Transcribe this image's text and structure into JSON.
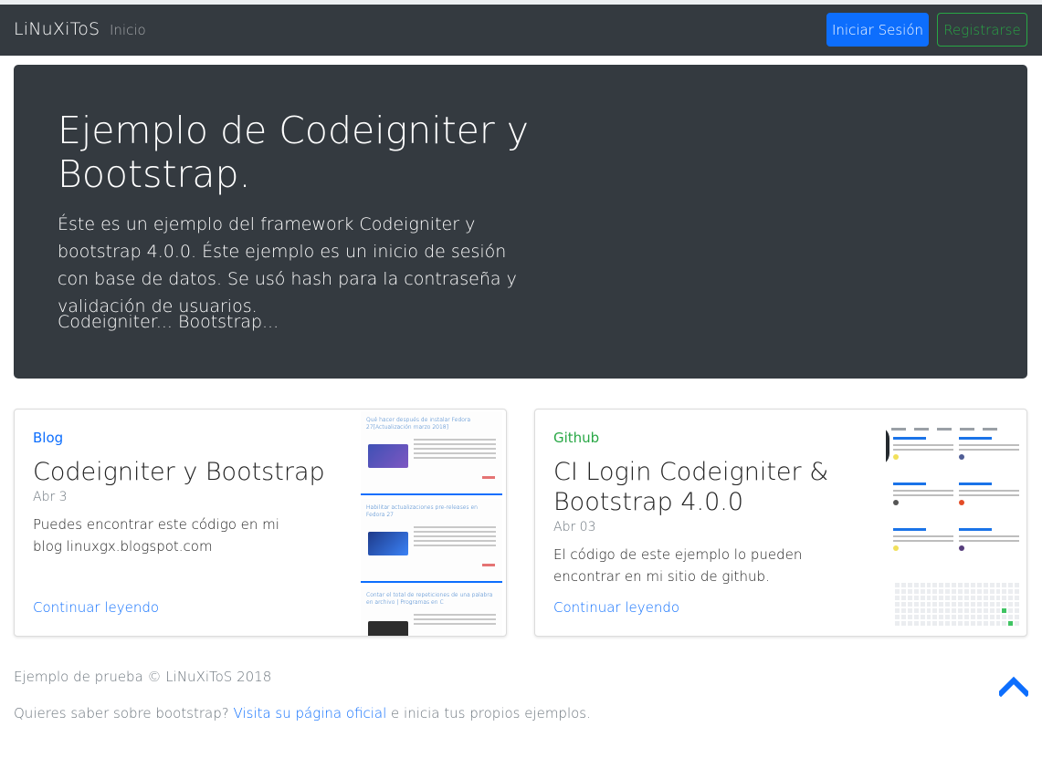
{
  "navbar": {
    "brand": "LiNuXiToS",
    "links": [
      "Inicio"
    ],
    "login_label": "Iniciar Sesión",
    "register_label": "Registrarse"
  },
  "hero": {
    "title": "Ejemplo de Codeigniter y Bootstrap.",
    "lead": "Éste es un ejemplo del framework Codeigniter y bootstrap 4.0.0. Éste ejemplo es un inicio de sesión con base de datos. Se usó hash para la contraseña y validación de usuarios.",
    "sub": "Codeigniter... Bootstrap..."
  },
  "cards": [
    {
      "category": "Blog",
      "title": "Codeigniter y Bootstrap",
      "date": "Abr 3",
      "text": "Puedes encontrar este código en mi blog linuxgx.blogspot.com",
      "link": "Continuar leyendo",
      "thumb_posts": [
        "Qué hacer después de instalar Fedora 27[Actualización marzo 2018]",
        "Habilitar actualizaciones pre-releases en Fedora 27",
        "Contar el total de repeticiones de una palabra en archivo | Programas en C"
      ]
    },
    {
      "category": "Github",
      "title": "CI Login Codeigniter & Bootstrap 4.0.0",
      "date": "Abr 03",
      "text": "El código de este ejemplo lo pueden encontrar en mi sitio de github.",
      "link": "Continuar leyendo"
    }
  ],
  "footer": {
    "copyright": "Ejemplo de prueba © LiNuXiToS 2018",
    "question": "Quieres saber sobre bootstrap?",
    "link": "Visita su página oficial",
    "tail": "e inicia tus propios ejemplos."
  },
  "colors": {
    "dark": "#343a40",
    "primary": "#0d6efd",
    "success": "#28a745"
  },
  "icons": {
    "back_to_top": "chevron-up-icon"
  }
}
